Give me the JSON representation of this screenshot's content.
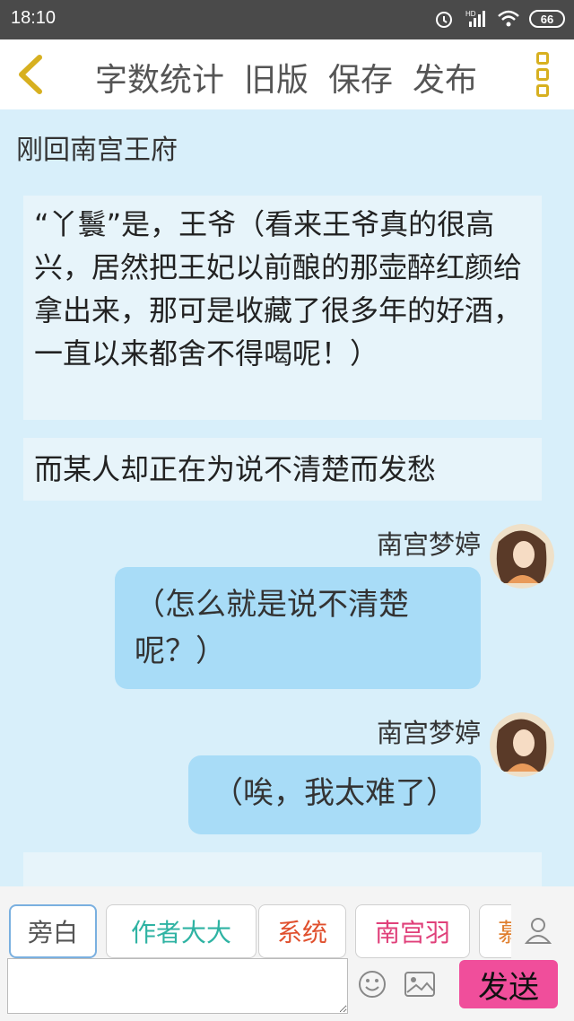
{
  "status_bar": {
    "time": "18:10",
    "battery": "66",
    "network": "HD"
  },
  "toolbar": {
    "back_icon": "chevron-left-icon",
    "actions": [
      "字数统计",
      "旧版",
      "保存",
      "发布"
    ],
    "menu_icon": "more-vertical-icon"
  },
  "chat": {
    "scene_title": "刚回南宫王府",
    "narration_1": "“丫鬟”是，王爷（看来王爷真的很高兴，居然把王妃以前酿的那壶醉红颜给拿出来，那可是收藏了很多年的好酒，一直以来都舍不得喝呢！）",
    "narration_2": "而某人却正在为说不清楚而发愁",
    "messages": [
      {
        "speaker": "南宫梦婷",
        "text": "（怎么就是说不清楚呢？）"
      },
      {
        "speaker": "南宫梦婷",
        "text": "（唉，我太难了）"
      }
    ]
  },
  "characters": [
    "旁白",
    "作者大大",
    "系统",
    "南宫羽",
    "慕"
  ],
  "input": {
    "placeholder": "",
    "send_label": "发送"
  },
  "colors": {
    "accent": "#f04e9b",
    "bubble": "#a8dcf7",
    "background": "#d8effa"
  }
}
